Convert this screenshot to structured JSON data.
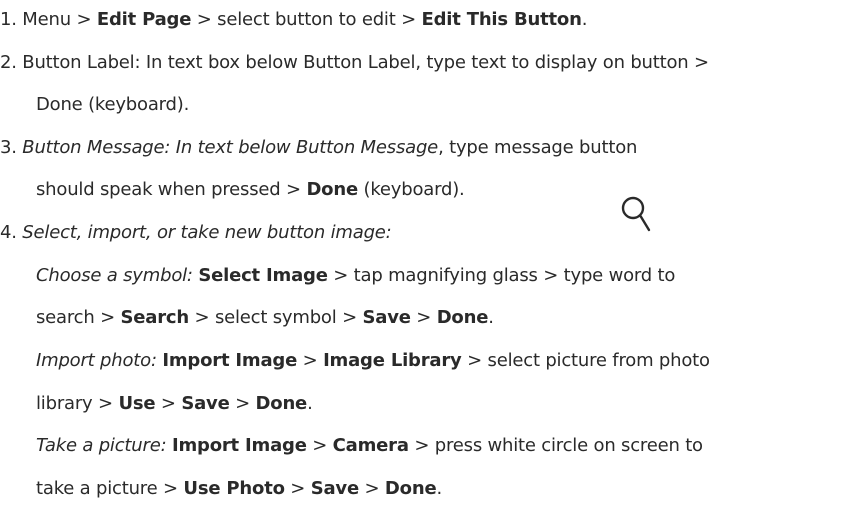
{
  "steps": [
    {
      "lines": [
        [
          {
            "t": "1. Menu > ",
            "s": ""
          },
          {
            "t": "Edit Page",
            "s": "b"
          },
          {
            "t": " > select button to edit > ",
            "s": ""
          },
          {
            "t": "Edit This Button",
            "s": "b"
          },
          {
            "t": ".",
            "s": ""
          }
        ]
      ]
    },
    {
      "lines": [
        [
          {
            "t": "2. Button Label: In text box below Button Label, type text to display on button >",
            "s": ""
          }
        ],
        [
          {
            "t": "Done (keyboard).",
            "s": ""
          }
        ]
      ]
    },
    {
      "lines": [
        [
          {
            "t": "3. ",
            "s": ""
          },
          {
            "t": "Button Message: In text below Button Message",
            "s": "i"
          },
          {
            "t": ", type message button",
            "s": ""
          }
        ],
        [
          {
            "t": "should speak when pressed > ",
            "s": ""
          },
          {
            "t": "Done",
            "s": "b"
          },
          {
            "t": " (keyboard).",
            "s": ""
          }
        ]
      ]
    },
    {
      "lines": [
        [
          {
            "t": "4. ",
            "s": ""
          },
          {
            "t": "Select, import, or take new button image:",
            "s": "i"
          }
        ],
        [
          {
            "t": "Choose a symbol: ",
            "s": "i"
          },
          {
            "t": "Select Image",
            "s": "b"
          },
          {
            "t": " > tap magnifying glass      > type word to",
            "s": ""
          }
        ],
        [
          {
            "t": "search > ",
            "s": ""
          },
          {
            "t": "Search",
            "s": "b"
          },
          {
            "t": " > select symbol > ",
            "s": ""
          },
          {
            "t": "Save",
            "s": "b"
          },
          {
            "t": " > ",
            "s": ""
          },
          {
            "t": "Done",
            "s": "b"
          },
          {
            "t": ".",
            "s": ""
          }
        ],
        [
          {
            "t": "Import photo: ",
            "s": "i"
          },
          {
            "t": "Import Image",
            "s": "b"
          },
          {
            "t": " > ",
            "s": ""
          },
          {
            "t": "Image Library",
            "s": "b"
          },
          {
            "t": " > select picture from photo",
            "s": ""
          }
        ],
        [
          {
            "t": "library > ",
            "s": ""
          },
          {
            "t": "Use",
            "s": "b"
          },
          {
            "t": " > ",
            "s": ""
          },
          {
            "t": "Save",
            "s": "b"
          },
          {
            "t": " > ",
            "s": ""
          },
          {
            "t": "Done",
            "s": "b"
          },
          {
            "t": ".",
            "s": ""
          }
        ],
        [
          {
            "t": "Take a picture: ",
            "s": "i"
          },
          {
            "t": "Import Image",
            "s": "b"
          },
          {
            "t": " > ",
            "s": ""
          },
          {
            "t": "Camera",
            "s": "b"
          },
          {
            "t": " > press white circle on screen to",
            "s": ""
          }
        ],
        [
          {
            "t": "take a picture > ",
            "s": ""
          },
          {
            "t": "Use Photo",
            "s": "b"
          },
          {
            "t": " > ",
            "s": ""
          },
          {
            "t": "Save",
            "s": "b"
          },
          {
            "t": " > ",
            "s": ""
          },
          {
            "t": "Done",
            "s": "b"
          },
          {
            "t": ".",
            "s": ""
          }
        ]
      ]
    }
  ],
  "icons": {
    "magnifier": "magnifying-glass-icon",
    "color": "#2a2a2a"
  }
}
